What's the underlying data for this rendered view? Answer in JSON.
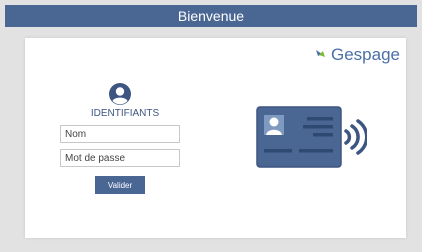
{
  "header": {
    "title": "Bienvenue"
  },
  "brand": {
    "name": "Gespage"
  },
  "login": {
    "section_title": "IDENTIFIANTS",
    "name_placeholder": "Nom",
    "password_placeholder": "Mot de passe",
    "submit_label": "Valider"
  },
  "icons": {
    "user": "user-circle-icon",
    "brand_logo": "gespage-logo-icon",
    "badge": "id-card-contactless-icon"
  },
  "colors": {
    "header_bg": "#4a6794",
    "accent": "#4a6794",
    "brand_blue": "#4b6fa8",
    "brand_green": "#7dbb3a",
    "page_bg": "#e2e2e2"
  }
}
